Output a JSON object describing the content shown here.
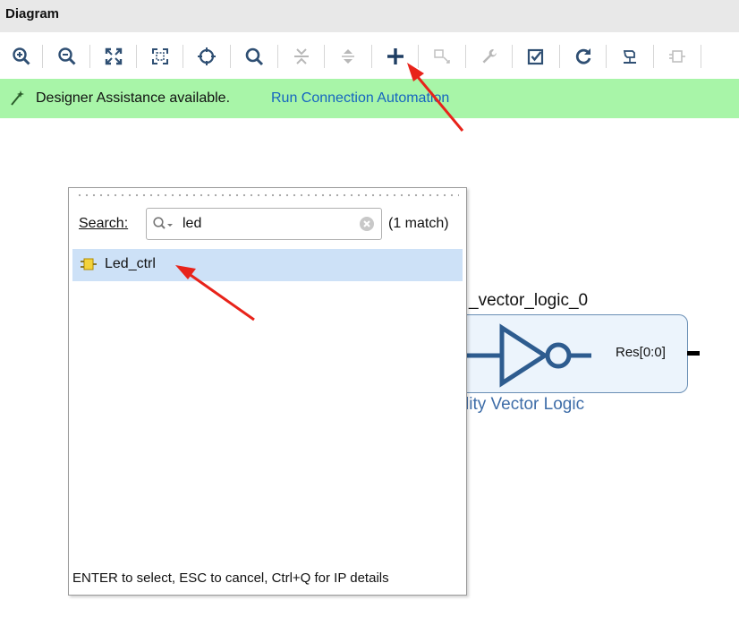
{
  "window": {
    "title": "Diagram"
  },
  "toolbar": {
    "buttons": [
      {
        "icon": "zoom-in-icon",
        "enabled": true
      },
      {
        "icon": "zoom-out-icon",
        "enabled": true
      },
      {
        "icon": "zoom-fit-icon",
        "enabled": true
      },
      {
        "icon": "zoom-selection-icon",
        "enabled": true
      },
      {
        "icon": "autofit-icon",
        "enabled": true
      },
      {
        "icon": "search-icon",
        "enabled": true
      },
      {
        "icon": "collapse-all-icon",
        "enabled": false
      },
      {
        "icon": "expand-all-icon",
        "enabled": false
      },
      {
        "icon": "add-ip-icon",
        "enabled": true
      },
      {
        "icon": "add-module-icon",
        "enabled": false
      },
      {
        "icon": "wrench-icon",
        "enabled": false
      },
      {
        "icon": "validate-design-icon",
        "enabled": true
      },
      {
        "icon": "refresh-icon",
        "enabled": true
      },
      {
        "icon": "regenerate-layout-icon",
        "enabled": true
      },
      {
        "icon": "port-icon",
        "enabled": false
      }
    ]
  },
  "banner": {
    "message": "Designer Assistance available.",
    "link": "Run Connection Automation",
    "background": "#a8f5a8"
  },
  "canvas": {
    "block_name": "_vector_logic_0",
    "block_subtitle": "lity Vector Logic",
    "output_pin": "Res[0:0]",
    "block_fill": "#ecf4fc",
    "block_stroke": "#6a8fb5"
  },
  "popup": {
    "search_label": "Search:",
    "search_value": "led",
    "match_count": "(1 match)",
    "results": [
      {
        "name": "Led_ctrl",
        "icon": "ip-core-icon",
        "selected": true
      }
    ],
    "footer": "ENTER to select, ESC to cancel, Ctrl+Q for IP details",
    "selection_color": "#cde1f7"
  },
  "annotation_color": "#e8231a"
}
